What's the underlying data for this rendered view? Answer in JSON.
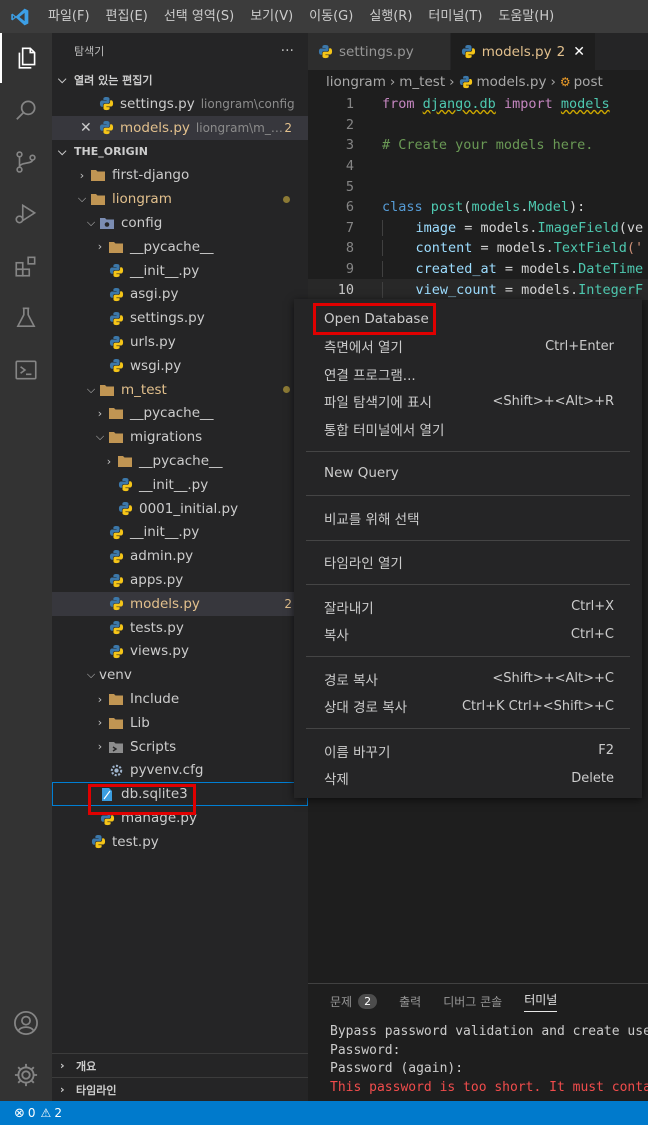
{
  "menubar": {
    "items": [
      "파일(F)",
      "편집(E)",
      "선택 영역(S)",
      "보기(V)",
      "이동(G)",
      "실행(R)",
      "터미널(T)",
      "도움말(H)"
    ]
  },
  "sidebar": {
    "title": "탐색기",
    "more": "···",
    "open_editors_title": "열려 있는 편집기",
    "open_editors": [
      {
        "name": "settings.py",
        "desc": "liongram\\config",
        "badge": ""
      },
      {
        "name": "models.py",
        "desc": "liongram\\m_t...",
        "badge": "2"
      }
    ],
    "workspace_title": "THE_ORIGIN",
    "tree": [
      {
        "name": "first-django"
      },
      {
        "name": "liongram"
      },
      {
        "name": "config"
      },
      {
        "name": "__pycache__"
      },
      {
        "name": "__init__.py"
      },
      {
        "name": "asgi.py"
      },
      {
        "name": "settings.py"
      },
      {
        "name": "urls.py"
      },
      {
        "name": "wsgi.py"
      },
      {
        "name": "m_test"
      },
      {
        "name": "__pycache__"
      },
      {
        "name": "migrations"
      },
      {
        "name": "__pycache__"
      },
      {
        "name": "__init__.py"
      },
      {
        "name": "0001_initial.py"
      },
      {
        "name": "__init__.py"
      },
      {
        "name": "admin.py"
      },
      {
        "name": "apps.py"
      },
      {
        "name": "models.py",
        "badge": "2"
      },
      {
        "name": "tests.py"
      },
      {
        "name": "views.py"
      },
      {
        "name": "venv"
      },
      {
        "name": "Include"
      },
      {
        "name": "Lib"
      },
      {
        "name": "Scripts"
      },
      {
        "name": "pyvenv.cfg"
      },
      {
        "name": "db.sqlite3"
      },
      {
        "name": "manage.py"
      },
      {
        "name": "test.py"
      }
    ],
    "outline_title": "개요",
    "timeline_title": "타임라인"
  },
  "editor": {
    "tabs": [
      {
        "label": "settings.py"
      },
      {
        "label": "models.py",
        "badge": "2",
        "close": "✕"
      }
    ],
    "breadcrumb": [
      "liongram",
      "m_test",
      "models.py",
      "post"
    ],
    "line_numbers": [
      "1",
      "2",
      "3",
      "4",
      "5",
      "6",
      "7",
      "8",
      "9",
      "10"
    ],
    "code": {
      "l1_from": "from",
      "l1_mod": "django.db",
      "l1_import": "import",
      "l1_name": "models",
      "l3_comment": "# Create your models here.",
      "l6_class": "class",
      "l6_name": "post",
      "l6_base_mod": "models",
      "l6_base_cls": "Model",
      "l6_tail": "):",
      "l7_var": "image",
      "l7_rest": " = models.",
      "l7_cls": "ImageField",
      "l7_tail": "(ve",
      "l8_var": "content",
      "l8_rest": " = models.",
      "l8_cls": "TextField",
      "l8_tail": "('",
      "l9_var": "created_at",
      "l9_rest": " = models.",
      "l9_cls": "DateTime",
      "l10_var": "view_count",
      "l10_rest": " = models.",
      "l10_cls": "IntegerF"
    }
  },
  "context_menu": {
    "groups": [
      [
        {
          "label": "Open Database",
          "shortcut": ""
        },
        {
          "label": "측면에서 열기",
          "shortcut": "Ctrl+Enter"
        },
        {
          "label": "연결 프로그램...",
          "shortcut": ""
        },
        {
          "label": "파일 탐색기에 표시",
          "shortcut": "<Shift>+<Alt>+R"
        },
        {
          "label": "통합 터미널에서 열기",
          "shortcut": ""
        }
      ],
      [
        {
          "label": "New Query",
          "shortcut": ""
        }
      ],
      [
        {
          "label": "비교를 위해 선택",
          "shortcut": ""
        }
      ],
      [
        {
          "label": "타임라인 열기",
          "shortcut": ""
        }
      ],
      [
        {
          "label": "잘라내기",
          "shortcut": "Ctrl+X"
        },
        {
          "label": "복사",
          "shortcut": "Ctrl+C"
        }
      ],
      [
        {
          "label": "경로 복사",
          "shortcut": "<Shift>+<Alt>+C"
        },
        {
          "label": "상대 경로 복사",
          "shortcut": "Ctrl+K Ctrl+<Shift>+C"
        }
      ],
      [
        {
          "label": "이름 바꾸기",
          "shortcut": "F2"
        },
        {
          "label": "삭제",
          "shortcut": "Delete"
        }
      ]
    ]
  },
  "panel": {
    "tabs": [
      {
        "label": "문제",
        "badge": "2"
      },
      {
        "label": "출력"
      },
      {
        "label": "디버그 콘솔"
      },
      {
        "label": "터미널"
      }
    ],
    "terminal_lines": [
      {
        "text": "Bypass password validation and create user",
        "error": false
      },
      {
        "text": "Password:",
        "error": false
      },
      {
        "text": "Password (again):",
        "error": false
      },
      {
        "text": "This password is too short. It must contai",
        "error": true
      }
    ]
  },
  "statusbar": {
    "errors": "0",
    "warnings": "2"
  },
  "colors": {
    "accent": "#007acc",
    "highlight_box": "#e00000",
    "modified": "#e2c08d"
  }
}
